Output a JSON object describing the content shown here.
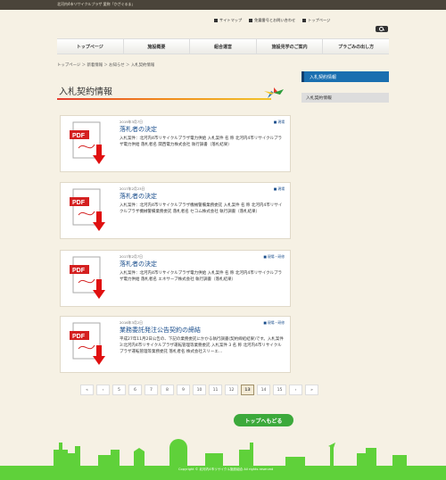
{
  "topbar": {
    "text": "北河内4市リサイクルプラザ 愛称「かざぐるま」"
  },
  "header": {
    "links": [
      "サイトマップ",
      "免震番号とお問い合わせ",
      "トップページ"
    ]
  },
  "nav": [
    "トップページ",
    "施設概要",
    "組合運営",
    "施設見学のご案内",
    "プラごみの出し方"
  ],
  "breadcrumb": "トップページ ＞ 新着情報 ＞ お知らせ ＞ 入札契約情報",
  "page_title": "入札契約情報",
  "sidebar": {
    "heading": "入札契約情報",
    "item": "入札契約情報"
  },
  "cards": [
    {
      "date": "2019年3月7日",
      "cat": "■ 現場",
      "title": "落札者の決定",
      "desc": "入札案件：北河内4市リサイクルプラザ電力供給 入札案件 名 称 北河内4市リサイクルプラザ電力供給 落札者名 関西電力株式会社 執行調書（落札結果）"
    },
    {
      "date": "2017年2月23日",
      "cat": "■ 現場",
      "title": "落札者の決定",
      "desc": "入札案件：北河内4市リサイクルプラザ機械警備業務委託 入札案件 名 称 北河内4市リサイクルプラザ機械警備業務委託 落札者名 セコム株式会社 執行調書（落札結果）"
    },
    {
      "date": "2017年2月7日",
      "cat": "■ 現場・研修",
      "title": "落札者の決定",
      "desc": "入札案件：北河内4市リサイクルプラザ電力供給 入札案件 名 称 北河内4市リサイクルプラザ電力供給 落札者名 エネサーブ株式会社 執行調書（落札結果）"
    },
    {
      "date": "2016年3月2日",
      "cat": "■ 現場・研修",
      "title": "業務委託発注公告契約の締結",
      "desc": "平成27年11月2日公告の、下記の業務委託にかかる執行調書(契約締結結果)です。入札案件3:北河内4市リサイクルプラザ運転管理等業務委託 入札案件 3 名 称 北河内4市リサイクルプラザ運転管理等業務委託 落札者名 株式会社スリーエ…"
    }
  ],
  "pager": [
    "«",
    "‹",
    "5",
    "6",
    "7",
    "8",
    "9",
    "10",
    "11",
    "12",
    "13",
    "14",
    "15",
    "›",
    "»"
  ],
  "pager_active": "13",
  "totop": "トップへもどる",
  "footer": {
    "copyright": "Copyright © 北河内4市リサイクル施設組合 All rights reserved"
  }
}
